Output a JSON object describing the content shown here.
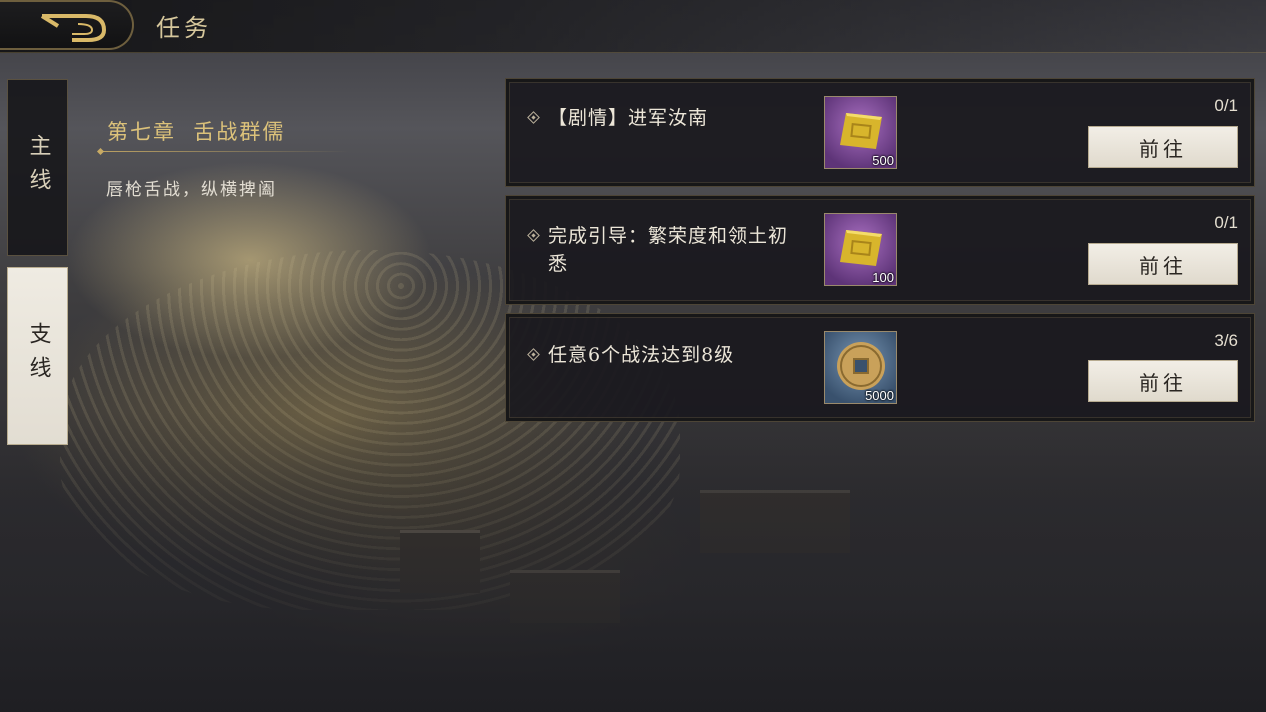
{
  "header": {
    "title": "任务",
    "back_icon": "back-arrow-icon"
  },
  "tabs": [
    {
      "label": "主线",
      "selected": false
    },
    {
      "label": "支线",
      "selected": true
    }
  ],
  "chapter": {
    "title": "第七章  舌战群儒",
    "subtitle": "唇枪舌战，纵横捭阖"
  },
  "quests": [
    {
      "text": "【剧情】进军汝南",
      "reward": {
        "icon": "gold-ingot-icon",
        "quantity": "500"
      },
      "progress": "0/1",
      "button_label": "前往"
    },
    {
      "text": "完成引导：繁荣度和领土初悉",
      "reward": {
        "icon": "gold-ingot-icon",
        "quantity": "100"
      },
      "progress": "0/1",
      "button_label": "前往"
    },
    {
      "text": "任意6个战法达到8级",
      "reward": {
        "icon": "copper-coin-icon",
        "quantity": "5000"
      },
      "progress": "3/6",
      "button_label": "前往"
    }
  ],
  "colors": {
    "gold_accent": "#dcc27a",
    "rare_purple": "#5e3478",
    "common_blue": "#39516d"
  }
}
